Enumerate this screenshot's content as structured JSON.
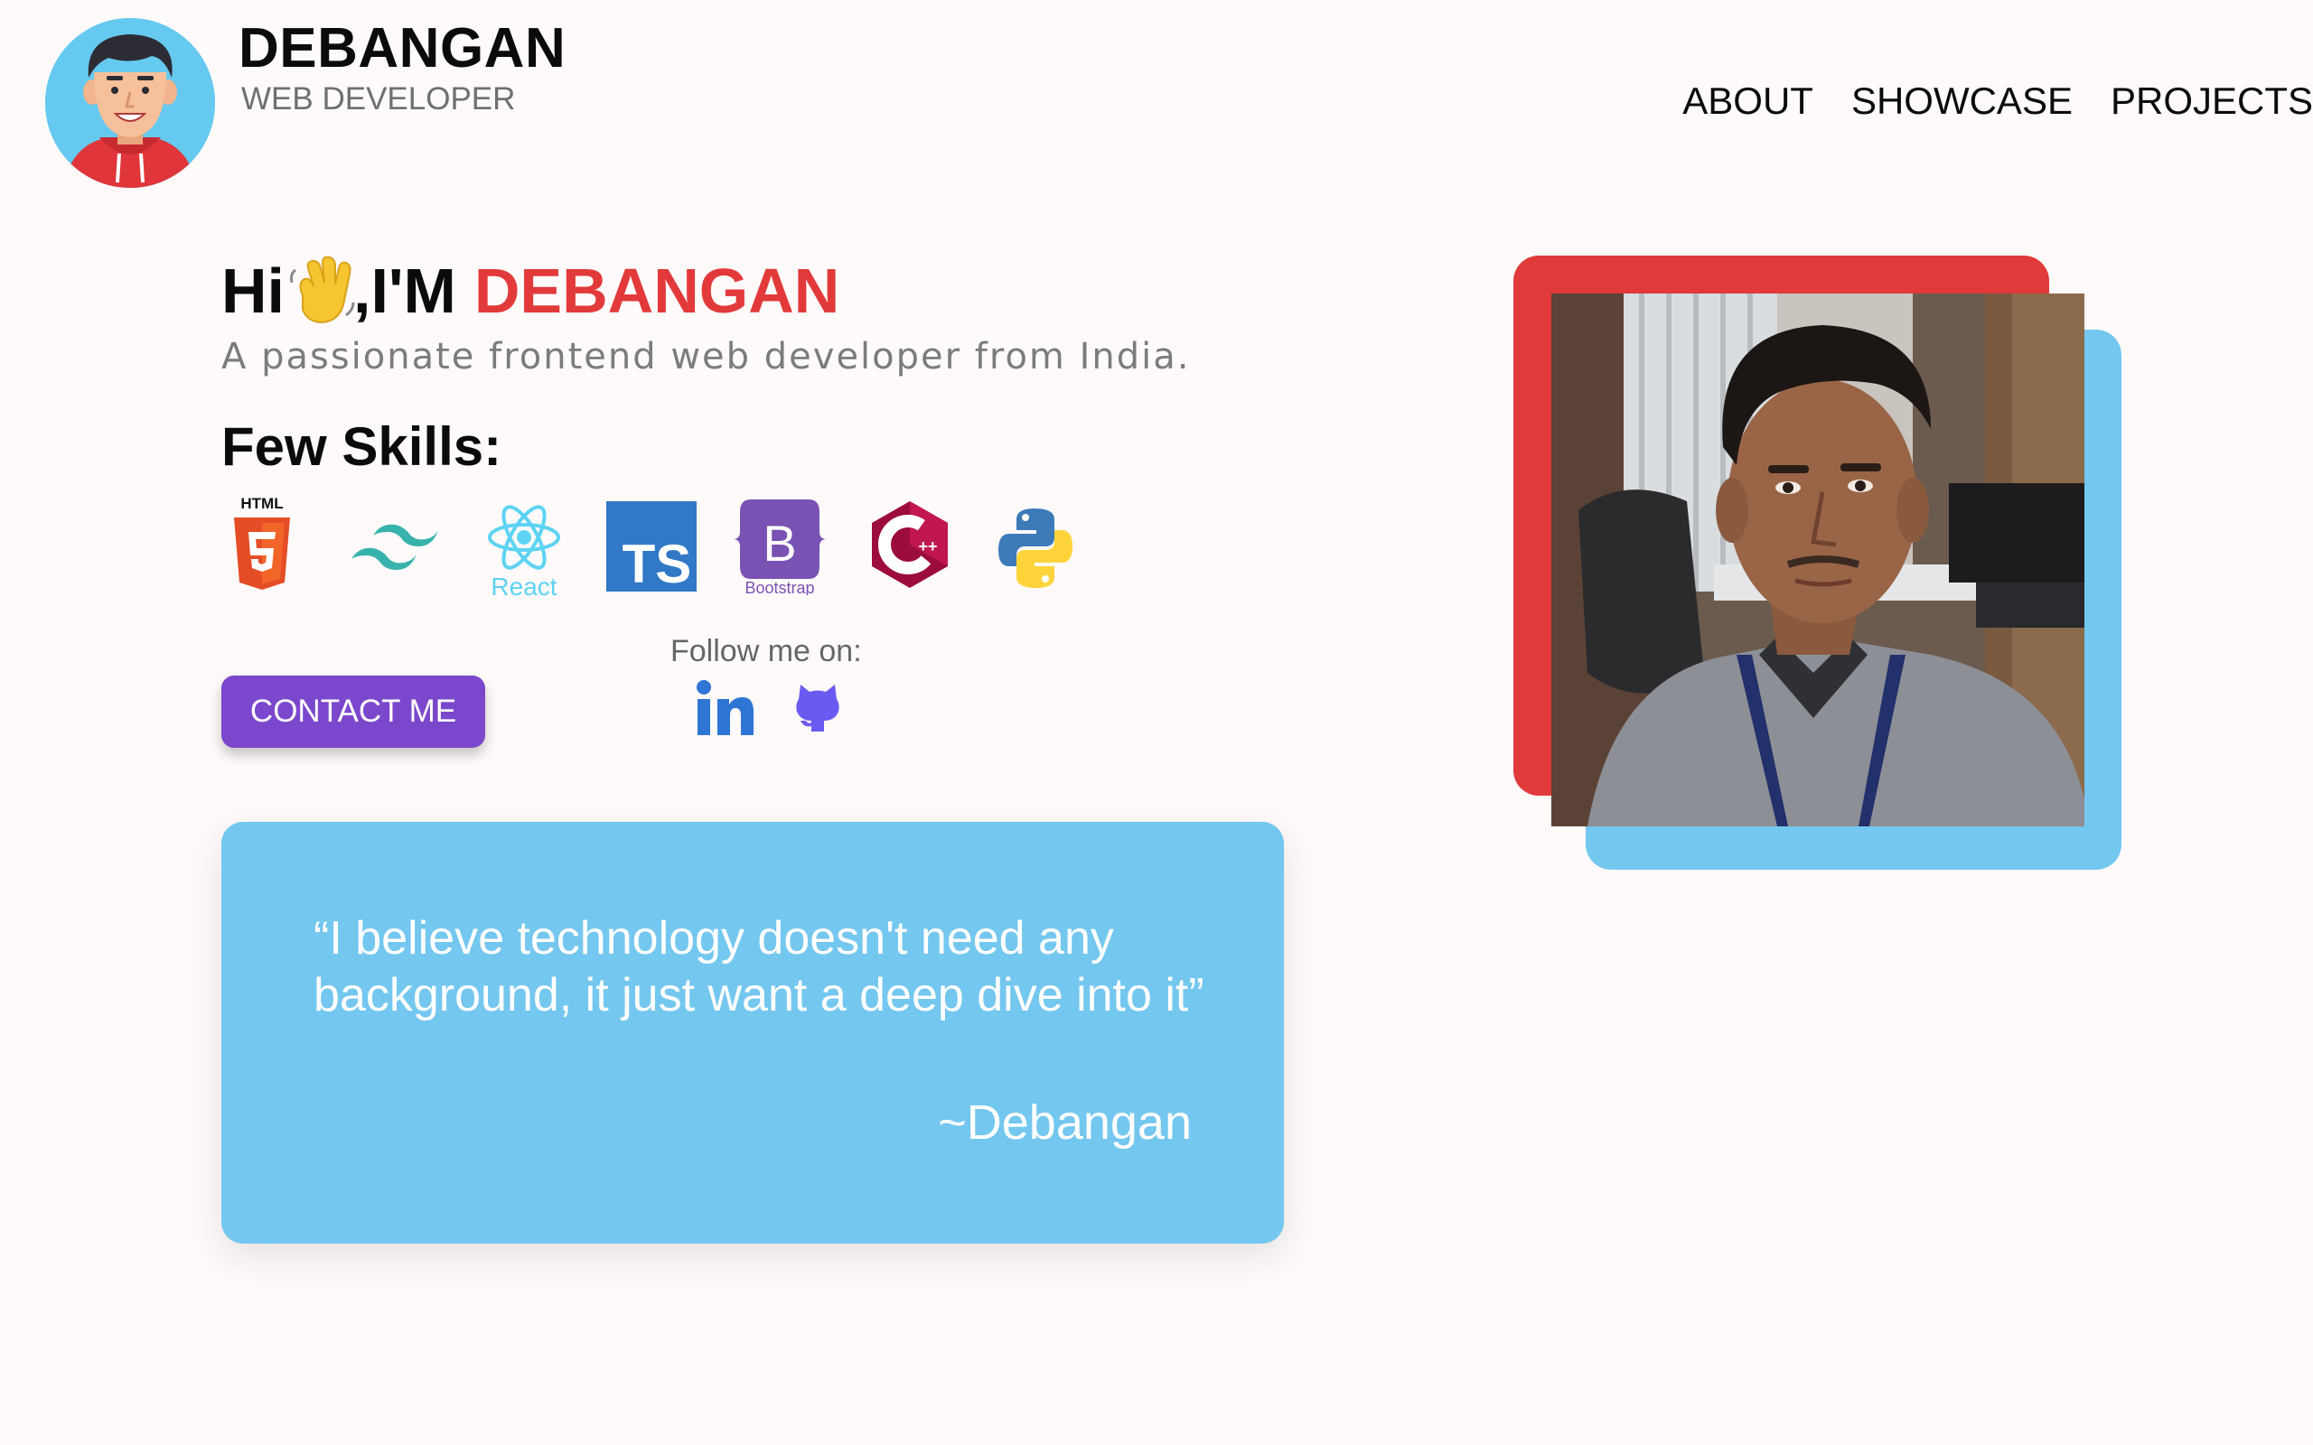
{
  "header": {
    "name": "DEBANGAN",
    "role": "WEB DEVELOPER",
    "avatar_icon": "cartoon-avatar-icon",
    "nav": [
      {
        "label": "ABOUT"
      },
      {
        "label": "SHOWCASE"
      },
      {
        "label": "PROJECTS"
      }
    ]
  },
  "hero": {
    "greeting_prefix": "Hi",
    "greeting_mid": ",I'M",
    "greeting_name": "DEBANGAN",
    "wave_icon": "waving-hand-icon",
    "tagline": "A passionate frontend web developer from India.",
    "skills_heading": "Few Skills:",
    "skills": [
      {
        "name": "HTML5",
        "icon": "html5-icon",
        "label": "HTML"
      },
      {
        "name": "Tailwind CSS",
        "icon": "tailwind-icon"
      },
      {
        "name": "React",
        "icon": "react-icon",
        "label": "React"
      },
      {
        "name": "TypeScript",
        "icon": "typescript-icon",
        "label": "TS"
      },
      {
        "name": "Bootstrap",
        "icon": "bootstrap-icon",
        "label": "Bootstrap"
      },
      {
        "name": "C++",
        "icon": "cplusplus-icon"
      },
      {
        "name": "Python",
        "icon": "python-icon"
      }
    ],
    "contact_label": "CONTACT ME",
    "follow_label": "Follow me on:",
    "socials": [
      {
        "name": "LinkedIn",
        "icon": "linkedin-icon"
      },
      {
        "name": "GitHub",
        "icon": "github-icon"
      }
    ]
  },
  "quote": {
    "text": "“I believe technology doesn't need any background, it just want a deep dive into it”",
    "author": "~Debangan"
  },
  "portrait": {
    "icon": "profile-photo"
  },
  "colors": {
    "accent_red": "#e23a3a",
    "accent_blue": "#74c7ef",
    "button_purple": "#7b47cc",
    "background": "#fffafa"
  }
}
